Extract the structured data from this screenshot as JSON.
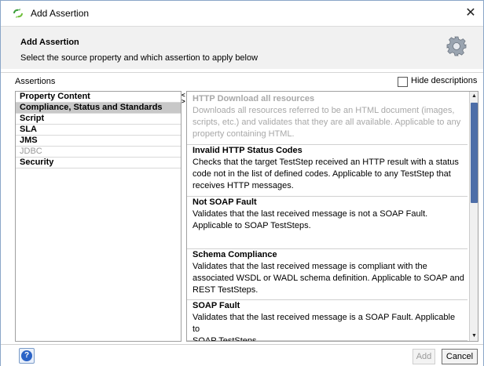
{
  "window": {
    "title": "Add Assertion",
    "close_glyph": "✕"
  },
  "header": {
    "title": "Add Assertion",
    "subtitle": "Select the source property and which assertion to apply below",
    "icon": "gear-icon"
  },
  "toolbar": {
    "label": "Assertions",
    "hide_descriptions_label": "Hide descriptions",
    "hide_descriptions_checked": false
  },
  "categories": [
    {
      "label": "Property Content",
      "selected": false,
      "enabled": true
    },
    {
      "label": "Compliance, Status and Standards",
      "selected": true,
      "enabled": true
    },
    {
      "label": "Script",
      "selected": false,
      "enabled": true
    },
    {
      "label": "SLA",
      "selected": false,
      "enabled": true
    },
    {
      "label": "JMS",
      "selected": false,
      "enabled": true
    },
    {
      "label": "JDBC",
      "selected": false,
      "enabled": false
    },
    {
      "label": "Security",
      "selected": false,
      "enabled": true
    }
  ],
  "assertions": [
    {
      "title": "HTTP Download all resources",
      "enabled": false,
      "lines": [
        "Downloads all resources referred to be an HTML document (images,",
        "scripts, etc.) and validates that they are all available. Applicable to any",
        "property containing HTML."
      ]
    },
    {
      "title": "Invalid HTTP Status Codes",
      "enabled": true,
      "lines": [
        "Checks that the target TestStep received an HTTP result with a status",
        "code not in the list of defined codes. Applicable to any TestStep that",
        "receives HTTP messages."
      ]
    },
    {
      "title": "Not SOAP Fault",
      "enabled": true,
      "lines": [
        "Validates that the last received message is not a SOAP Fault.",
        "Applicable to SOAP TestSteps."
      ]
    },
    {
      "title": "Schema Compliance",
      "enabled": true,
      "lines": [
        "Validates that the last received message is compliant with the",
        "associated WSDL or WADL schema definition. Applicable to SOAP and",
        "REST TestSteps."
      ]
    },
    {
      "title": "SOAP Fault",
      "enabled": true,
      "lines": [
        "Validates that the last received message is a SOAP Fault. Applicable to",
        "SOAP TestSteps."
      ]
    }
  ],
  "buttons": {
    "help_glyph": "?",
    "add": "Add",
    "cancel": "Cancel"
  },
  "colors": {
    "accent": "#4d6ea8",
    "selected_row": "#c8c8c8",
    "disabled_text": "#a8a8a8"
  }
}
